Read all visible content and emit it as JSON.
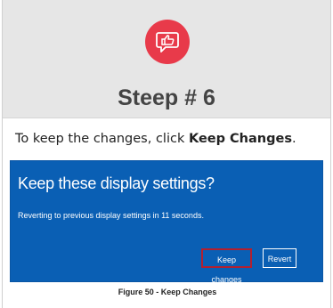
{
  "header": {
    "badge_icon": "thumbs-up-speech-bubble-icon",
    "badge_color": "#e83a4a",
    "step_title": "Steep # 6"
  },
  "instruction": {
    "prefix": "To keep the changes, click ",
    "emphasis": "Keep Changes",
    "suffix": "."
  },
  "dialog": {
    "title": "Keep these display settings?",
    "subtitle": "Reverting to previous display settings in 11 seconds.",
    "keep_button": "Keep changes",
    "revert_button": "Revert",
    "background_color": "#0a5fb4",
    "highlight_color": "#b22030"
  },
  "caption": "Figure 50 - Keep Changes"
}
